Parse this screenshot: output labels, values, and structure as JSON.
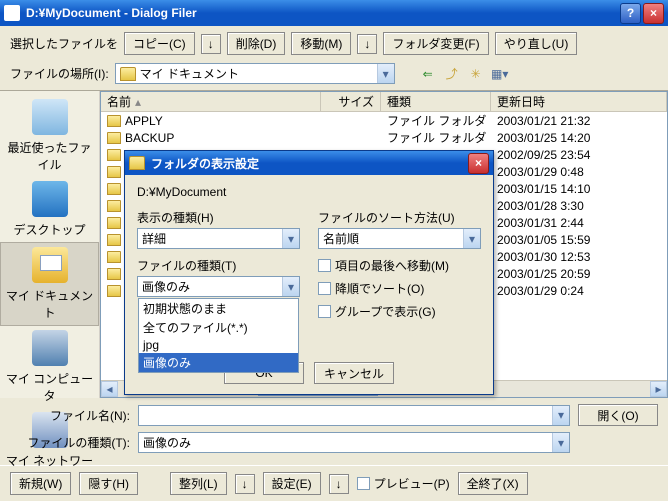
{
  "window_title": "D:¥MyDocument - Dialog Filer",
  "toolbar": {
    "selected_label": "選択したファイルを",
    "copy": "コピー(C)",
    "delete": "削除(D)",
    "move": "移動(M)",
    "change_folder": "フォルダ変更(F)",
    "undo": "やり直し(U)"
  },
  "location_label": "ファイルの場所(I):",
  "location_value": "マイ ドキュメント",
  "places": {
    "recent": "最近使ったファイル",
    "desktop": "デスクトップ",
    "mydoc": "マイ ドキュメント",
    "mycomp": "マイ コンピュータ",
    "mynet": "マイ ネットワーク"
  },
  "columns": {
    "name": "名前",
    "size": "サイズ",
    "type": "種類",
    "date": "更新日時"
  },
  "rows": [
    {
      "name": "APPLY",
      "type": "ファイル フォルダ",
      "date": "2003/01/21 21:32"
    },
    {
      "name": "BACKUP",
      "type": "ファイル フォルダ",
      "date": "2003/01/25 14:20"
    },
    {
      "name": "",
      "type": "",
      "date": "2002/09/25 23:54"
    },
    {
      "name": "",
      "type": "",
      "date": "2003/01/29 0:48"
    },
    {
      "name": "",
      "type": "",
      "date": "2003/01/15 14:10"
    },
    {
      "name": "",
      "type": "",
      "date": "2003/01/28 3:30"
    },
    {
      "name": "",
      "type": "",
      "date": "2003/01/31 2:44"
    },
    {
      "name": "",
      "type": "",
      "date": "2003/01/05 15:59"
    },
    {
      "name": "",
      "type": "",
      "date": "2003/01/30 12:53"
    },
    {
      "name": "",
      "type": "",
      "date": "2003/01/25 20:59"
    },
    {
      "name": "",
      "type": "",
      "date": "2003/01/29 0:24"
    }
  ],
  "filename_label": "ファイル名(N):",
  "filename_value": "",
  "filetype_label": "ファイルの種類(T):",
  "filetype_value": "画像のみ",
  "open_btn": "開く(O)",
  "footer": {
    "new": "新規(W)",
    "hide": "隠す(H)",
    "align": "整列(L)",
    "settings": "設定(E)",
    "preview": "プレビュー(P)",
    "closeall": "全終了(X)"
  },
  "modal": {
    "title": "フォルダの表示設定",
    "path": "D:¥MyDocument",
    "display_type_label": "表示の種類(H)",
    "display_type_value": "詳細",
    "sort_label": "ファイルのソート方法(U)",
    "sort_value": "名前順",
    "file_type_label": "ファイルの種類(T)",
    "file_type_value": "画像のみ",
    "dd_items": [
      "初期状態のまま",
      "全てのファイル(*.*)",
      "jpg",
      "画像のみ"
    ],
    "chk_move_last": "項目の最後へ移動(M)",
    "chk_desc": "降順でソート(O)",
    "chk_group": "グループで表示(G)",
    "ok": "OK",
    "cancel": "キャンセル"
  }
}
